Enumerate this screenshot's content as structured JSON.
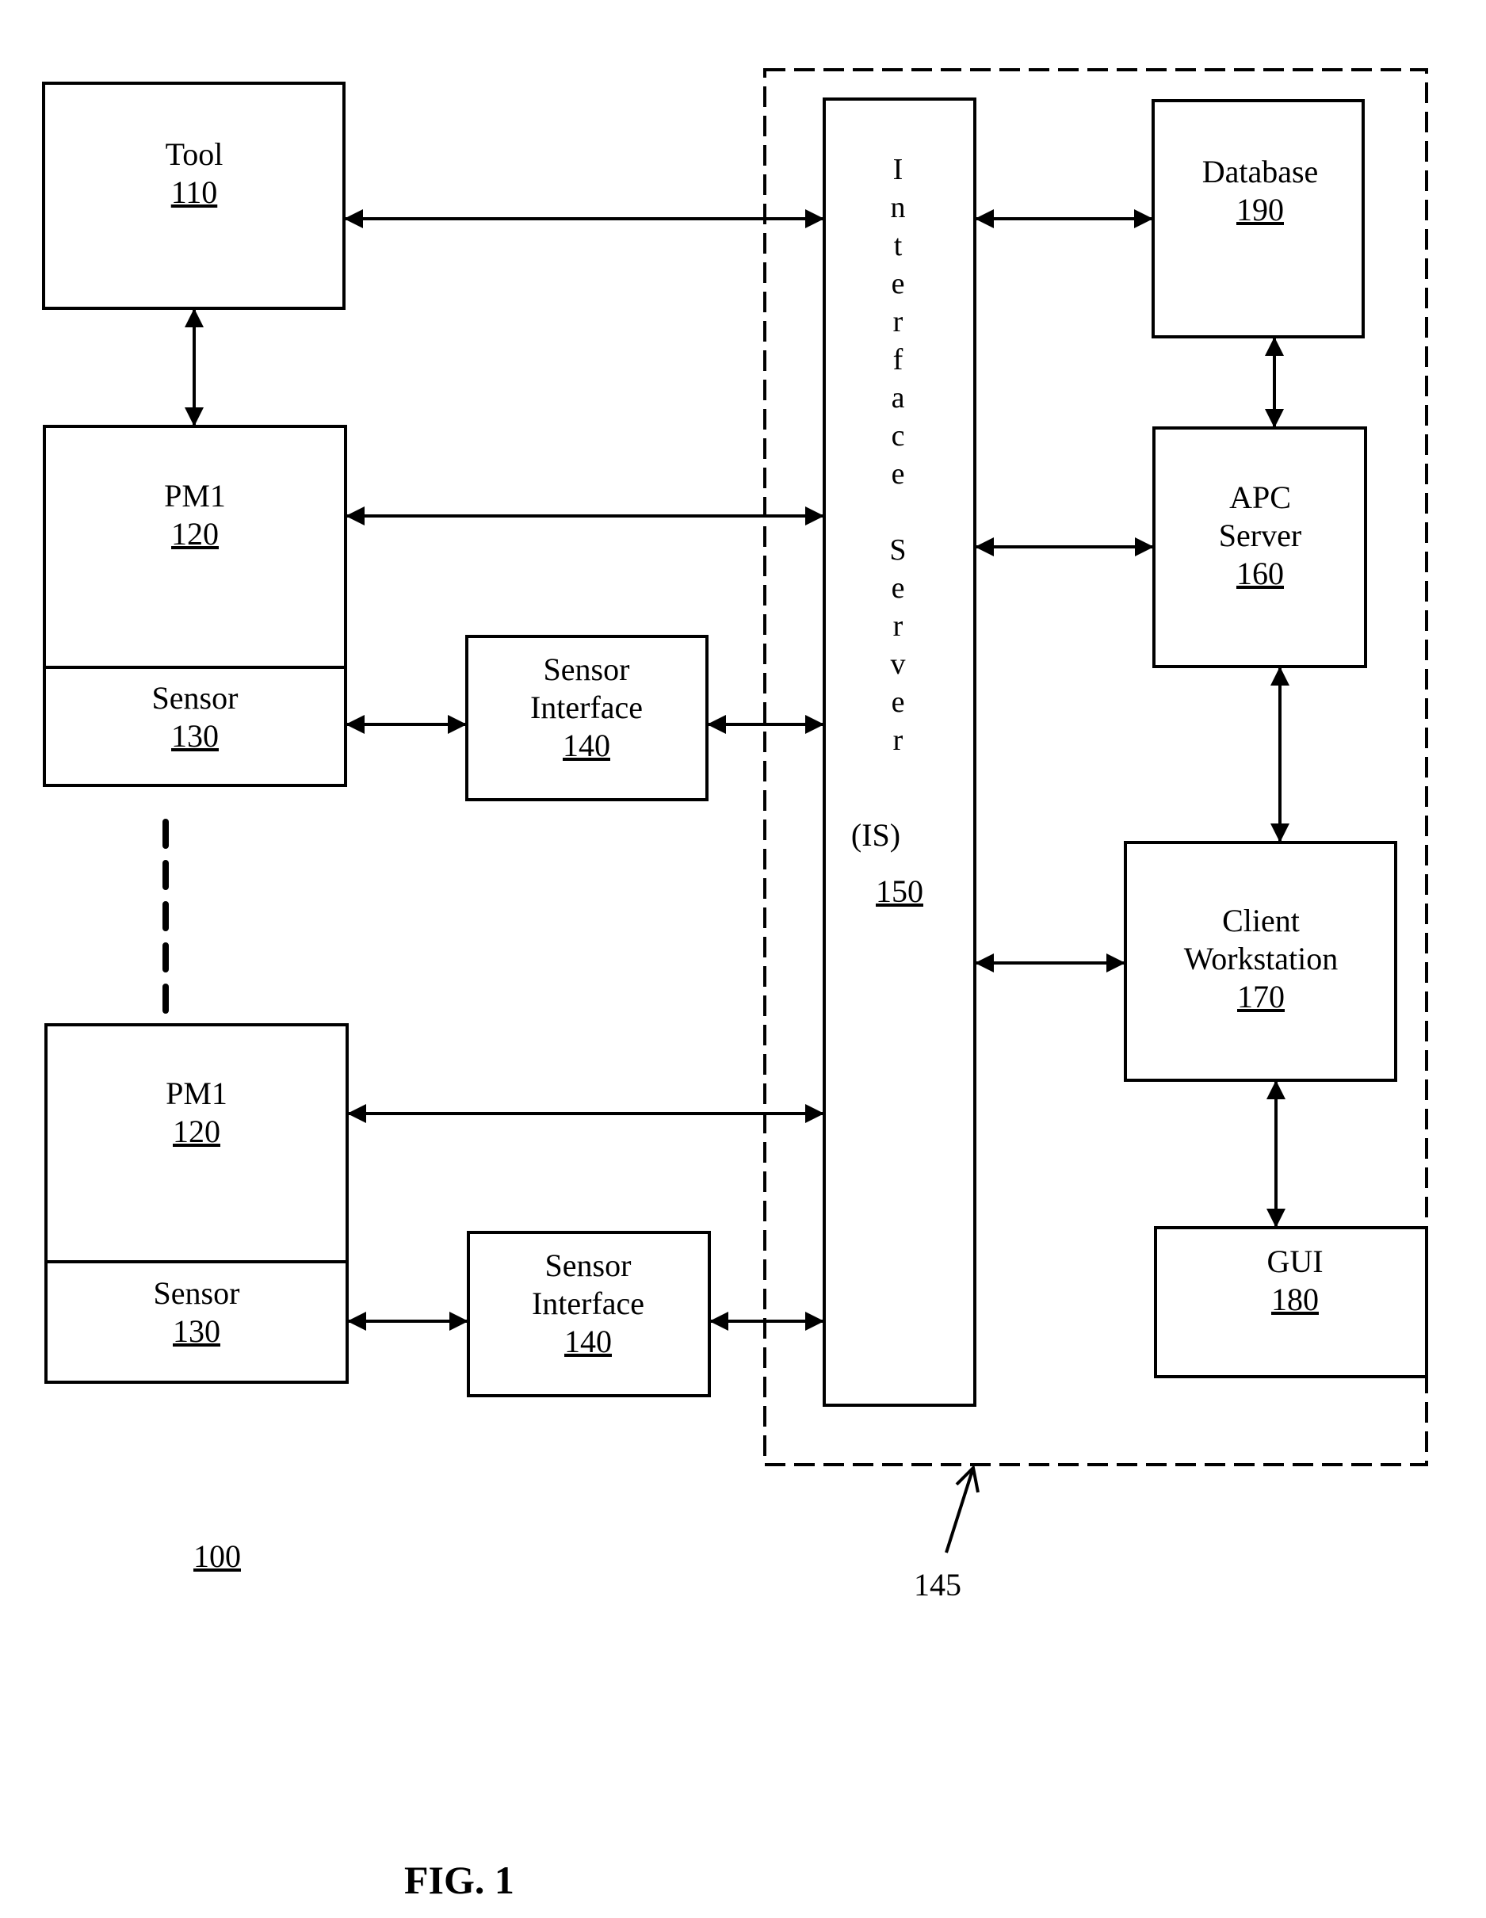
{
  "figure": {
    "caption": "FIG. 1",
    "system_ref": "100",
    "boundary_ref": "145"
  },
  "blocks": {
    "tool": {
      "name": "Tool",
      "ref": "110"
    },
    "pm1_a": {
      "name": "PM1",
      "ref": "120"
    },
    "sensor_a": {
      "name": "Sensor",
      "ref": "130"
    },
    "sensor_interface_a": {
      "line1": "Sensor",
      "line2": "Interface",
      "ref": "140"
    },
    "pm1_b": {
      "name": "PM1",
      "ref": "120"
    },
    "sensor_b": {
      "name": "Sensor",
      "ref": "130"
    },
    "sensor_interface_b": {
      "line1": "Sensor",
      "line2": "Interface",
      "ref": "140"
    },
    "interface_server": {
      "letters_line1": [
        "I",
        "n",
        "t",
        "e",
        "r",
        "f",
        "a",
        "c",
        "e"
      ],
      "letters_line2": [
        "S",
        "e",
        "r",
        "v",
        "e",
        "r"
      ],
      "abbrev": "(IS)",
      "ref": "150"
    },
    "database": {
      "name": "Database",
      "ref": "190"
    },
    "apc_server": {
      "line1": "APC",
      "line2": "Server",
      "ref": "160"
    },
    "client_workstation": {
      "line1": "Client",
      "line2": "Workstation",
      "ref": "170"
    },
    "gui": {
      "name": "GUI",
      "ref": "180"
    }
  },
  "connections": [
    {
      "from": "tool",
      "to": "interface_server",
      "type": "bidirectional"
    },
    {
      "from": "tool",
      "to": "pm1_a",
      "type": "bidirectional"
    },
    {
      "from": "pm1_a",
      "to": "interface_server",
      "type": "bidirectional"
    },
    {
      "from": "sensor_a",
      "to": "sensor_interface_a",
      "type": "bidirectional"
    },
    {
      "from": "sensor_interface_a",
      "to": "interface_server",
      "type": "bidirectional"
    },
    {
      "from": "pm1_b",
      "to": "interface_server",
      "type": "bidirectional"
    },
    {
      "from": "sensor_b",
      "to": "sensor_interface_b",
      "type": "bidirectional"
    },
    {
      "from": "sensor_interface_b",
      "to": "interface_server",
      "type": "bidirectional"
    },
    {
      "from": "interface_server",
      "to": "database",
      "type": "bidirectional"
    },
    {
      "from": "database",
      "to": "apc_server",
      "type": "bidirectional"
    },
    {
      "from": "interface_server",
      "to": "apc_server",
      "type": "bidirectional"
    },
    {
      "from": "apc_server",
      "to": "client_workstation",
      "type": "bidirectional"
    },
    {
      "from": "interface_server",
      "to": "client_workstation",
      "type": "bidirectional"
    },
    {
      "from": "client_workstation",
      "to": "gui",
      "type": "bidirectional"
    }
  ]
}
